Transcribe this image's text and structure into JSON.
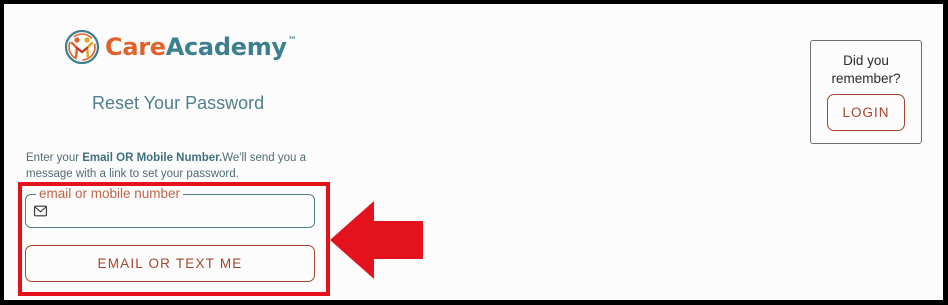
{
  "brand": {
    "name_part1": "Care",
    "name_part2": "Academy",
    "trademark": "™"
  },
  "reset": {
    "title": "Reset Your Password",
    "instructions_prefix": "Enter your ",
    "instructions_bold": "Email OR Mobile Number.",
    "instructions_suffix": "We'll send you a message with a link to set your password.",
    "field_label": "email or mobile number",
    "field_value": "",
    "field_icon": "mail-icon",
    "submit_label": "EMAIL OR TEXT ME"
  },
  "sidebar": {
    "remember_text": "Did you remember?",
    "login_label": "LOGIN"
  },
  "colors": {
    "accent": "#a6452c",
    "brand_orange": "#e0632b",
    "brand_teal": "#3d7f8e",
    "highlight_red": "#e3121d"
  }
}
